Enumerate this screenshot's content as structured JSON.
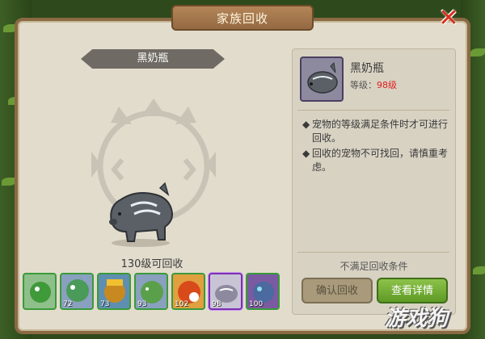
{
  "window": {
    "title": "家族回收",
    "close_icon": "close-x-icon"
  },
  "selected_pet": {
    "name": "黑奶瓶",
    "level_label": "等级：",
    "level_value": "98级"
  },
  "recycle_requirement": "130级可回收",
  "tips": [
    "宠物的等级满足条件时才可进行回收。",
    "回收的宠物不可找回，请慎重考虑。"
  ],
  "tip_bullet": "◆",
  "condition_text": "不满足回收条件",
  "buttons": {
    "confirm": "确认回收",
    "detail": "查看详情"
  },
  "pet_list": [
    {
      "level": "",
      "color": "#3f9a3a"
    },
    {
      "level": "72",
      "color": "#4a9a5a"
    },
    {
      "level": "73",
      "color": "#c88a20"
    },
    {
      "level": "93",
      "color": "#5aa04a"
    },
    {
      "level": "102",
      "color": "#d84a1a"
    },
    {
      "level": "98",
      "color": "#8d8aa0"
    },
    {
      "level": "100",
      "color": "#4a6aa0"
    }
  ],
  "watermark": "游戏狗"
}
